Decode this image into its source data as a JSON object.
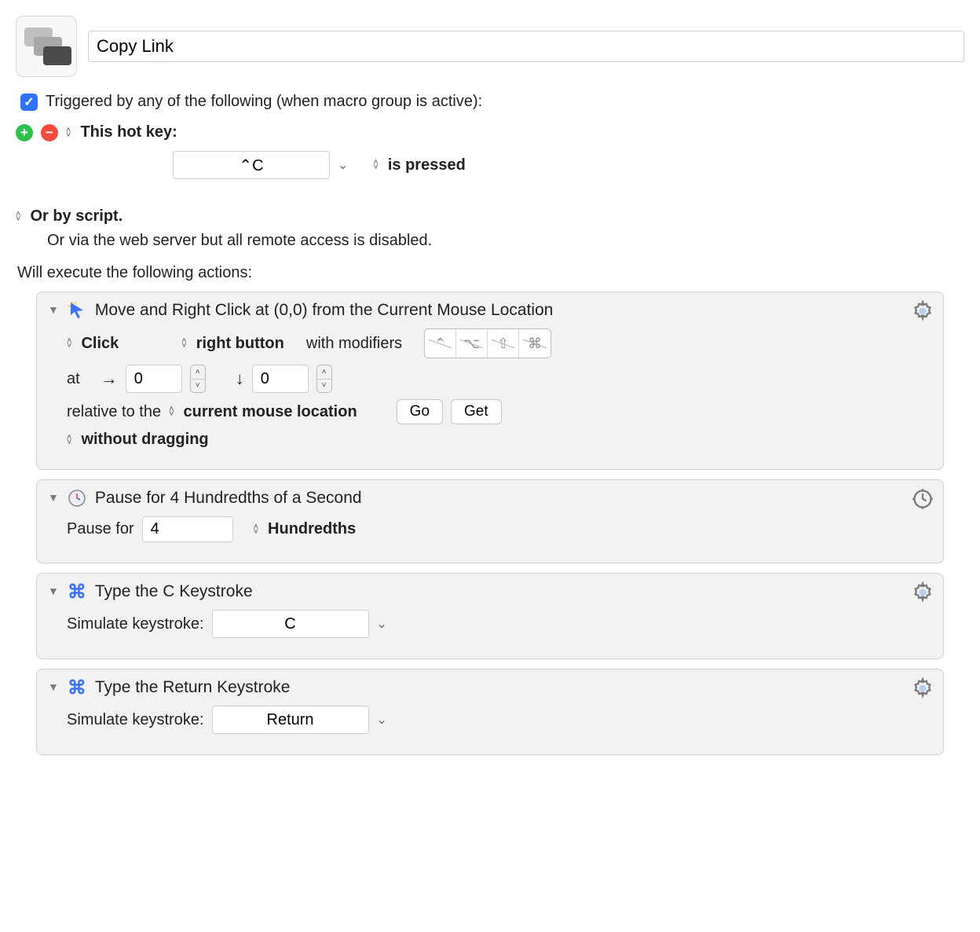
{
  "header": {
    "macro_name": "Copy Link"
  },
  "trigger": {
    "label": "Triggered by any of the following (when macro group is active):",
    "hotkey": {
      "label": "This hot key:",
      "value": "⌃C",
      "state_label": "is pressed"
    },
    "or_script": "Or by script.",
    "web_server": "Or via the web server but all remote access is disabled."
  },
  "exec_label": "Will execute the following actions:",
  "actions": [
    {
      "kind": "mouse",
      "title": "Move and Right Click at (0,0) from the Current Mouse Location",
      "click_type": "Click",
      "button": "right button",
      "with_modifiers_label": "with modifiers",
      "modifiers": {
        "ctrl": false,
        "option": false,
        "shift": false,
        "cmd": false
      },
      "at_label": "at",
      "x": "0",
      "y": "0",
      "relative_label": "relative to the",
      "relative_to": "current mouse location",
      "go_label": "Go",
      "get_label": "Get",
      "drag_mode": "without dragging"
    },
    {
      "kind": "pause",
      "title": "Pause for 4 Hundredths of a Second",
      "pause_for_label": "Pause for",
      "value": "4",
      "unit": "Hundredths"
    },
    {
      "kind": "keystroke",
      "title": "Type the C Keystroke",
      "simulate_label": "Simulate keystroke:",
      "key": "C"
    },
    {
      "kind": "keystroke",
      "title": "Type the Return Keystroke",
      "simulate_label": "Simulate keystroke:",
      "key": "Return"
    }
  ]
}
